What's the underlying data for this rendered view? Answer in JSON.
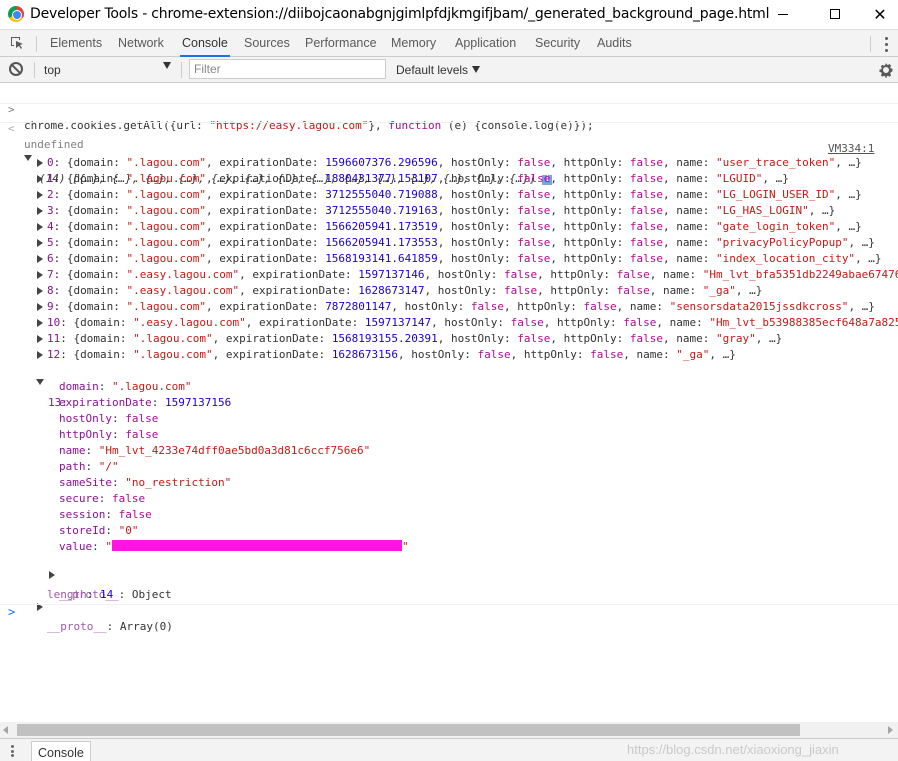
{
  "window": {
    "title": "Developer Tools - chrome-extension://diibojcaonabgnjgimlpfdjkmgifjbam/_generated_background_page.html",
    "minimize_glyph": "—",
    "close_glyph": "✕"
  },
  "tabs": [
    "Elements",
    "Network",
    "Console",
    "Sources",
    "Performance",
    "Memory",
    "Application",
    "Security",
    "Audits"
  ],
  "active_tab": "Console",
  "console_toolbar": {
    "context": "top",
    "filter_placeholder": "Filter",
    "levels": "Default levels"
  },
  "console": {
    "command": {
      "prefix": "chrome.cookies.getAll({url: ",
      "url": "\"https://easy.lagou.com\"",
      "mid": "}, ",
      "keyword": "function",
      "suffix": " (e) {console.log(e)});"
    },
    "result": "undefined",
    "source_link": "VM334:1",
    "array_summary": "(14) [{…}, {…}, {…}, {…}, {…}, {…}, {…}, {…}, {…}, {…}, {…}, {…}, {…}, {…}]",
    "info_badge": "i",
    "rows": [
      {
        "idx": "0",
        "domain": "\".lagou.com\"",
        "expirationDate": "1596607376.296596",
        "hostOnly": "false",
        "httpOnly": "false",
        "name": "\"user_trace_token\"",
        "tail": ", …}"
      },
      {
        "idx": "1",
        "domain": "\".lagou.com\"",
        "expirationDate": "1880431377.153107",
        "hostOnly": "false",
        "httpOnly": "false",
        "name": "\"LGUID\"",
        "tail": ", …}"
      },
      {
        "idx": "2",
        "domain": "\".lagou.com\"",
        "expirationDate": "3712555040.719088",
        "hostOnly": "false",
        "httpOnly": "false",
        "name": "\"LG_LOGIN_USER_ID\"",
        "tail": ", …}"
      },
      {
        "idx": "3",
        "domain": "\".lagou.com\"",
        "expirationDate": "3712555040.719163",
        "hostOnly": "false",
        "httpOnly": "false",
        "name": "\"LG_HAS_LOGIN\"",
        "tail": ", …}"
      },
      {
        "idx": "4",
        "domain": "\".lagou.com\"",
        "expirationDate": "1566205941.173519",
        "hostOnly": "false",
        "httpOnly": "false",
        "name": "\"gate_login_token\"",
        "tail": ", …}"
      },
      {
        "idx": "5",
        "domain": "\".lagou.com\"",
        "expirationDate": "1566205941.173553",
        "hostOnly": "false",
        "httpOnly": "false",
        "name": "\"privacyPolicyPopup\"",
        "tail": ", …}"
      },
      {
        "idx": "6",
        "domain": "\".lagou.com\"",
        "expirationDate": "1568193141.641859",
        "hostOnly": "false",
        "httpOnly": "false",
        "name": "\"index_location_city\"",
        "tail": ", …}"
      },
      {
        "idx": "7",
        "domain": "\".easy.lagou.com\"",
        "expirationDate": "1597137146",
        "hostOnly": "false",
        "httpOnly": "false",
        "name": "\"Hm_lvt_bfa5351db2249abae67476",
        "tail": ""
      },
      {
        "idx": "8",
        "domain": "\".easy.lagou.com\"",
        "expirationDate": "1628673147",
        "hostOnly": "false",
        "httpOnly": "false",
        "name": "\"_ga\"",
        "tail": ", …}"
      },
      {
        "idx": "9",
        "domain": "\".lagou.com\"",
        "expirationDate": "7872801147",
        "hostOnly": "false",
        "httpOnly": "false",
        "name": "\"sensorsdata2015jssdkcross\"",
        "tail": ", …}"
      },
      {
        "idx": "10",
        "domain": "\".easy.lagou.com\"",
        "expirationDate": "1597137147",
        "hostOnly": "false",
        "httpOnly": "false",
        "name": "\"Hm_lvt_b53988385ecf648a7a825",
        "tail": ""
      },
      {
        "idx": "11",
        "domain": "\".lagou.com\"",
        "expirationDate": "1568193155.20391",
        "hostOnly": "false",
        "httpOnly": "false",
        "name": "\"gray\"",
        "tail": ", …}"
      },
      {
        "idx": "12",
        "domain": "\".lagou.com\"",
        "expirationDate": "1628673156",
        "hostOnly": "false",
        "httpOnly": "false",
        "name": "\"_ga\"",
        "tail": ", …}"
      }
    ],
    "expanded_index": "13:",
    "expanded": {
      "domain": "\".lagou.com\"",
      "expirationDate": "1597137156",
      "hostOnly": "false",
      "httpOnly": "false",
      "name": "\"Hm_lvt_4233e74dff0ae5bd0a3d81c6ccf756e6\"",
      "path": "\"/\"",
      "sameSite": "\"no_restriction\"",
      "secure": "false",
      "session": "false",
      "storeId": "\"0\"",
      "value_open": "\"",
      "value_close": "\""
    },
    "proto_object": "Object",
    "length_value": "14",
    "proto_array": "Array(0)"
  },
  "drawer": {
    "tab": "Console",
    "watermark": "https://blog.csdn.net/xiaoxiong_jiaxin"
  },
  "colors": {
    "string": "#c41a16",
    "number": "#1c00cf",
    "keyword": "#aa0d91",
    "property": "#881391",
    "accent": "#1a73e8",
    "redaction": "#ff14e6"
  }
}
